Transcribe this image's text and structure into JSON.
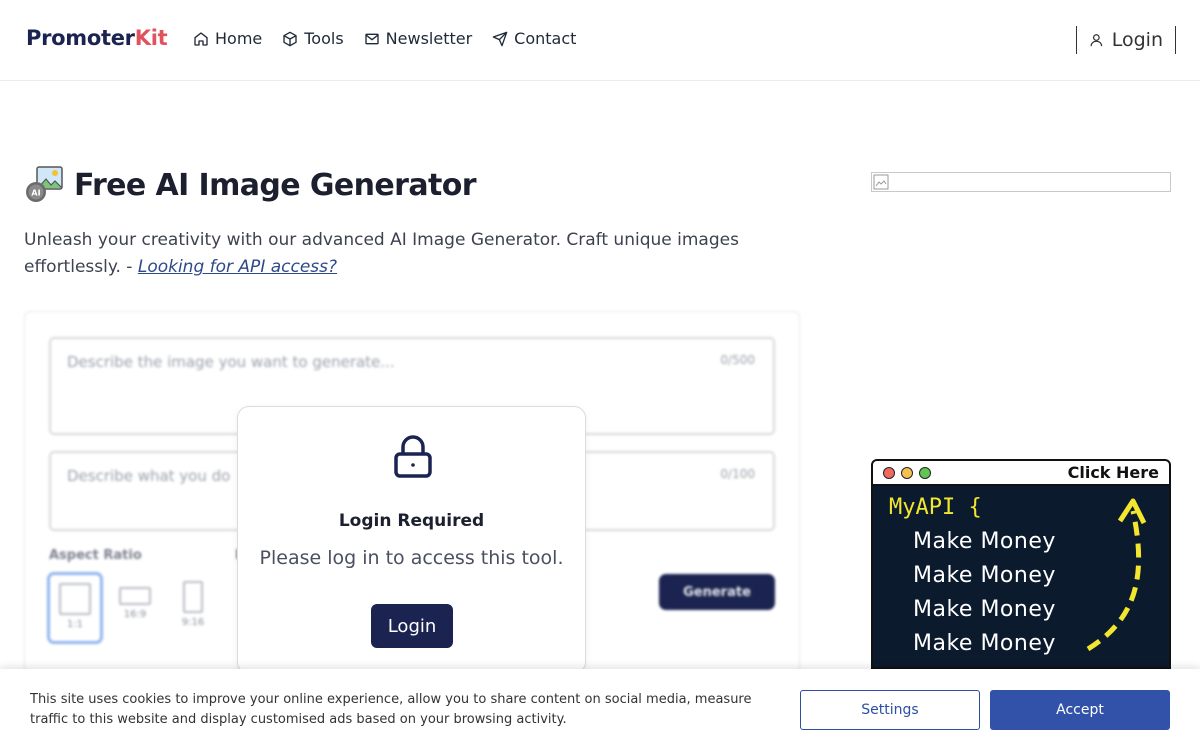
{
  "header": {
    "logo_part1": "Promoter",
    "logo_part2": "Kit",
    "nav": [
      {
        "label": "Home",
        "icon": "home-icon"
      },
      {
        "label": "Tools",
        "icon": "cube-icon"
      },
      {
        "label": "Newsletter",
        "icon": "mail-icon"
      },
      {
        "label": "Contact",
        "icon": "send-icon"
      }
    ],
    "login_label": "Login"
  },
  "main": {
    "title": "Free AI Image Generator",
    "subtitle": "Unleash your creativity with our advanced AI Image Generator. Craft unique images effortlessly. - ",
    "api_link": "Looking for API access?",
    "tool": {
      "prompt_placeholder": "Describe the image you want to generate...",
      "prompt_counter": "0/500",
      "negative_placeholder": "Describe what you do",
      "negative_counter": "0/100",
      "aspect_label": "Aspect Ratio",
      "aspect_label2": "I",
      "ratios": [
        "1:1",
        "16:9",
        "9:16"
      ],
      "generate_label": "Generate"
    }
  },
  "modal": {
    "heading": "Login Required",
    "message": "Please log in to access this tool.",
    "button": "Login"
  },
  "ad": {
    "click_here": "Click Here",
    "line1": "MyAPI {",
    "lines": [
      "Make Money",
      "Make Money",
      "Make Money",
      "Make Money"
    ]
  },
  "cookie": {
    "text": "This site uses cookies to improve your online experience, allow you to share content on social media, measure traffic to this website and display customised ads based on your browsing activity.",
    "settings": "Settings",
    "accept": "Accept"
  },
  "colors": {
    "brand_navy": "#1b2450",
    "brand_red": "#e0525e",
    "accept_blue": "#3152a8",
    "ad_bg": "#0c1a2e",
    "ad_yellow": "#f3e62e"
  }
}
